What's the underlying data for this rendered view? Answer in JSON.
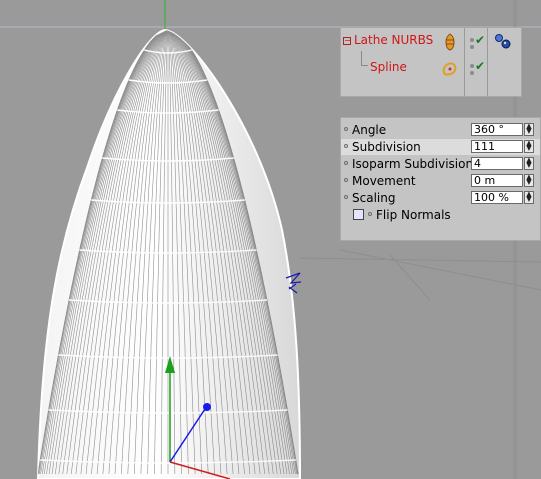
{
  "object_manager": {
    "objects": [
      {
        "name": "Lathe NURBS",
        "icon": "lathe-nurbs-icon",
        "enabled": true
      },
      {
        "name": "Spline",
        "icon": "spline-icon",
        "enabled": true
      }
    ],
    "tag": "texture-tag-icon"
  },
  "attributes": {
    "rows": [
      {
        "label": "Angle",
        "value": "360 °"
      },
      {
        "label": "Subdivision",
        "value": "111"
      },
      {
        "label": "Isoparm Subdivision",
        "value": "4"
      },
      {
        "label": "Movement",
        "value": "0 m"
      },
      {
        "label": "Scaling",
        "value": "100 %"
      }
    ],
    "flip_normals": {
      "label": "Flip Normals",
      "checked": false
    }
  },
  "colors": {
    "viewport_bg": "#9a9a9a",
    "object_name": "#d01616",
    "panel_bg": "#c4c4c4",
    "axis_y": "#1aa01a",
    "axis_z": "#1a1aee",
    "axis_x": "#cc2020"
  }
}
